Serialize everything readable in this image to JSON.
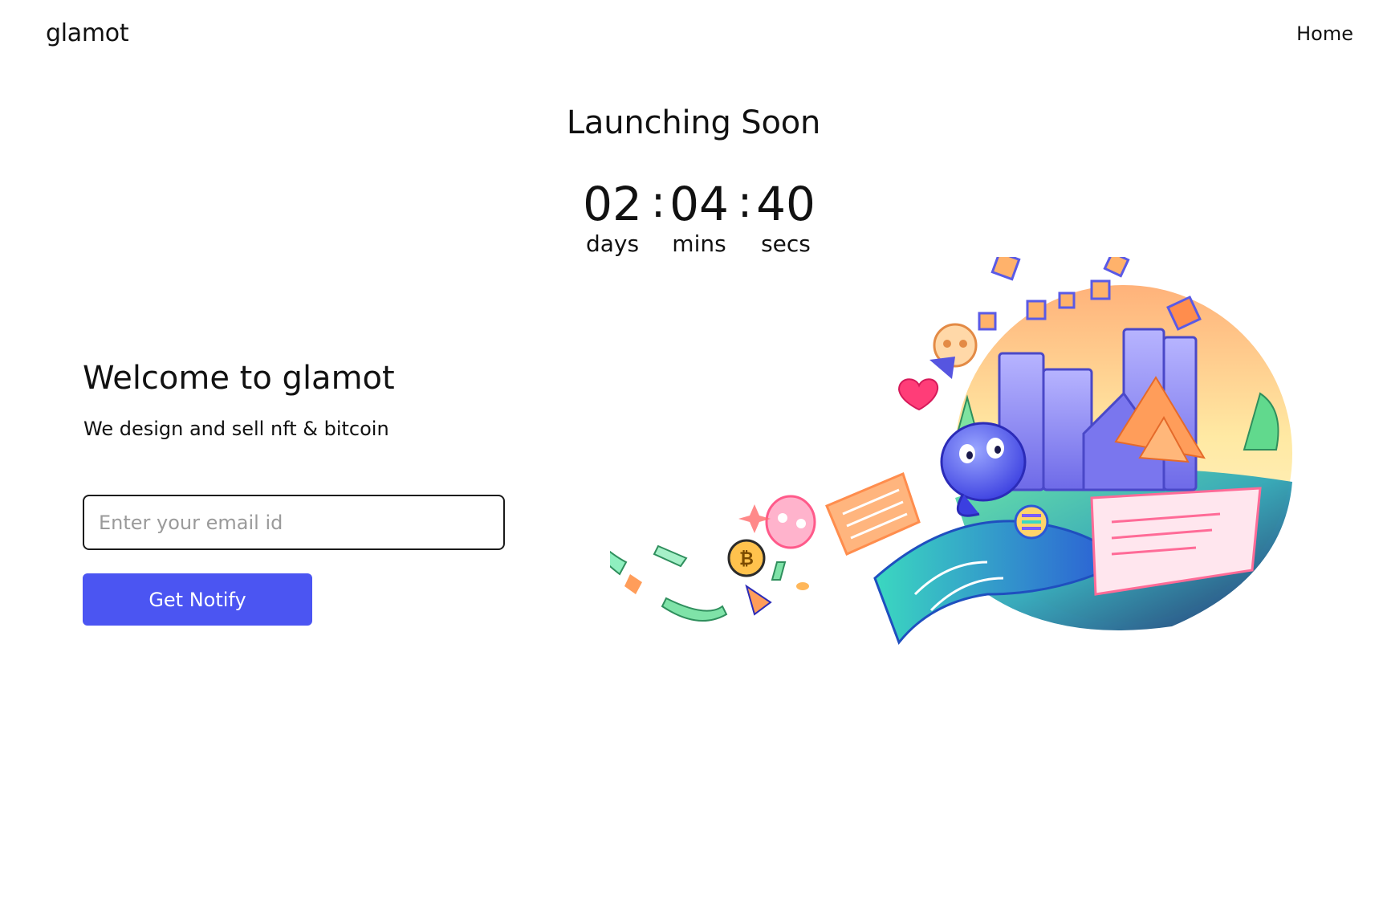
{
  "header": {
    "brand": "glamot",
    "nav_home": "Home"
  },
  "launch": {
    "title": "Launching Soon",
    "countdown": {
      "days": "02",
      "mins": "04",
      "secs": "40",
      "separator": ":",
      "days_label": "days",
      "mins_label": "mins",
      "secs_label": "secs"
    }
  },
  "hero": {
    "heading": "Welcome to glamot",
    "subheading": "We design and sell nft & bitcoin",
    "email_placeholder": "Enter your email id",
    "email_value": "",
    "button_label": "Get Notify"
  },
  "colors": {
    "accent": "#4b55f2",
    "text": "#111111",
    "placeholder": "#9a9a9a"
  },
  "illustration": {
    "icon": "nft-crypto-illustration"
  }
}
